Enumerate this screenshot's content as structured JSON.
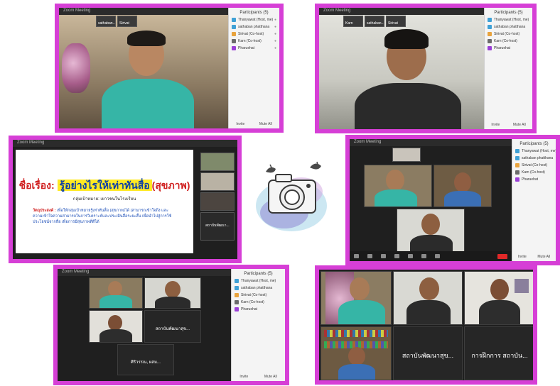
{
  "app_title": "Zoom Meeting",
  "participants_title": "Participants (5)",
  "panel_footer": [
    "Invite",
    "Mute All"
  ],
  "participants": [
    "Thanyawat (Host, me)",
    "sathaban phatthana",
    "Sirivat (Co-host)",
    "Karn (Co-host)",
    "Pharuehat"
  ],
  "shot1": {
    "thumb_labels": [
      "sathaban...",
      "Sirivat"
    ]
  },
  "shot2": {
    "thumb_labels": [
      "Karn",
      "sathaban...",
      "Sirivat"
    ]
  },
  "slide": {
    "title_prefix": "ชื่อเรื่อง:",
    "title_main": "รู้อย่างไรให้เท่าทันสื่อ",
    "title_suffix": "(สุขภาพ)",
    "subtitle": "กลุ่มเป้าหมาย: เยาวชนในโรงเรียน",
    "objective_label": "วัตถุประสงค์ :",
    "objective_text": "เพื่อให้กลุ่มเป้าหมายรู้เท่าทันสื่อ (สุขภาพ)ได้ (สามารถเข้าใจถึง และความเข้าใจความสามารถในการวิเคราะห์และประเมินสื่อระยะสั้น เพื่อนำไปสู่การใช้ประโยชน์จากสื่อ เพื่อการมีสุขภาพที่ดีได้",
    "side_label": "สถาบันพัฒนา..."
  },
  "shot4": {
    "tiles": [
      "sathaban phatthana",
      "Sirivat"
    ]
  },
  "shot5": {
    "tiles": [
      "สถาบันพัฒนาสุข...",
      "ศิริวรรณ, ผสม..."
    ]
  },
  "shot6": {
    "tiles": [
      "สถาบันพัฒนาสุข...",
      "การฝึกการ สถาบัน..."
    ]
  }
}
